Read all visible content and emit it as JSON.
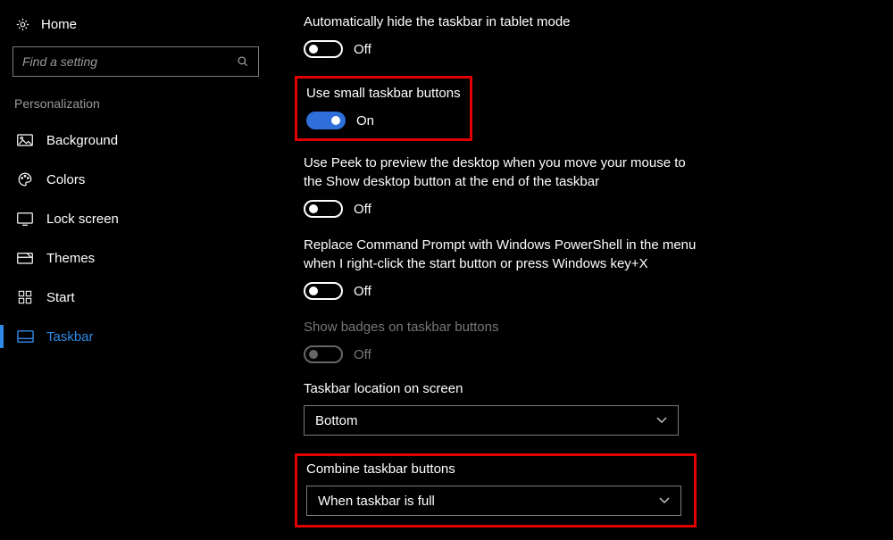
{
  "sidebar": {
    "home_label": "Home",
    "search_placeholder": "Find a setting",
    "category_label": "Personalization",
    "items": [
      {
        "label": "Background"
      },
      {
        "label": "Colors"
      },
      {
        "label": "Lock screen"
      },
      {
        "label": "Themes"
      },
      {
        "label": "Start"
      },
      {
        "label": "Taskbar"
      }
    ]
  },
  "settings": {
    "auto_hide_tablet": {
      "label": "Automatically hide the taskbar in tablet mode",
      "state": "Off"
    },
    "small_buttons": {
      "label": "Use small taskbar buttons",
      "state": "On"
    },
    "use_peek": {
      "label": "Use Peek to preview the desktop when you move your mouse to the Show desktop button at the end of the taskbar",
      "state": "Off"
    },
    "powershell": {
      "label": "Replace Command Prompt with Windows PowerShell in the menu when I right-click the start button or press Windows key+X",
      "state": "Off"
    },
    "badges": {
      "label": "Show badges on taskbar buttons",
      "state": "Off"
    },
    "location": {
      "label": "Taskbar location on screen",
      "value": "Bottom"
    },
    "combine": {
      "label": "Combine taskbar buttons",
      "value": "When taskbar is full"
    }
  }
}
